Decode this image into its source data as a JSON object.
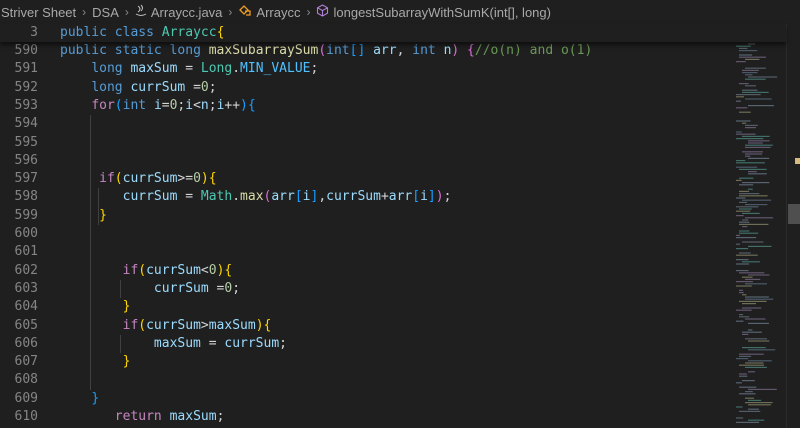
{
  "breadcrumb": {
    "items": [
      {
        "label": "Striver Sheet",
        "icon": ""
      },
      {
        "label": "DSA",
        "icon": ""
      },
      {
        "label": "Arraycc.java",
        "icon": "java-file-icon"
      },
      {
        "label": "Arraycc",
        "icon": "class-icon"
      },
      {
        "label": "longestSubarrayWithSumK(int[], long)",
        "icon": "method-icon"
      }
    ]
  },
  "sticky": {
    "line_number": "3",
    "tokens": [
      {
        "t": "public ",
        "c": "kw"
      },
      {
        "t": "class ",
        "c": "kw"
      },
      {
        "t": "Arraycc",
        "c": "ty"
      },
      {
        "t": "{",
        "c": "b1"
      }
    ]
  },
  "lines": [
    {
      "n": "590",
      "tokens": [
        {
          "t": "public ",
          "c": "kw"
        },
        {
          "t": "static ",
          "c": "kw"
        },
        {
          "t": "long ",
          "c": "kw"
        },
        {
          "t": "maxSubarraySum",
          "c": "fn"
        },
        {
          "t": "(",
          "c": "b2"
        },
        {
          "t": "int",
          "c": "kw"
        },
        {
          "t": "[] ",
          "c": "b3"
        },
        {
          "t": "arr",
          "c": "vr"
        },
        {
          "t": ", ",
          "c": "op"
        },
        {
          "t": "int ",
          "c": "kw"
        },
        {
          "t": "n",
          "c": "vr"
        },
        {
          "t": ") ",
          "c": "b2"
        },
        {
          "t": "{",
          "c": "b2"
        },
        {
          "t": "//o(n) and o(1)",
          "c": "cm"
        }
      ]
    },
    {
      "n": "591",
      "tokens": [
        {
          "t": "    ",
          "c": "op"
        },
        {
          "t": "long ",
          "c": "kw"
        },
        {
          "t": "maxSum",
          "c": "vr"
        },
        {
          "t": " = ",
          "c": "op"
        },
        {
          "t": "Long",
          "c": "ty"
        },
        {
          "t": ".",
          "c": "op"
        },
        {
          "t": "MIN_VALUE",
          "c": "cn"
        },
        {
          "t": ";",
          "c": "op"
        }
      ]
    },
    {
      "n": "592",
      "tokens": [
        {
          "t": "    ",
          "c": "op"
        },
        {
          "t": "long ",
          "c": "kw"
        },
        {
          "t": "currSum",
          "c": "vr"
        },
        {
          "t": " =",
          "c": "op"
        },
        {
          "t": "0",
          "c": "nm"
        },
        {
          "t": ";",
          "c": "op"
        }
      ]
    },
    {
      "n": "593",
      "tokens": [
        {
          "t": "    ",
          "c": "op"
        },
        {
          "t": "for",
          "c": "ctl"
        },
        {
          "t": "(",
          "c": "b3"
        },
        {
          "t": "int ",
          "c": "kw"
        },
        {
          "t": "i",
          "c": "vr"
        },
        {
          "t": "=",
          "c": "op"
        },
        {
          "t": "0",
          "c": "nm"
        },
        {
          "t": ";",
          "c": "op"
        },
        {
          "t": "i",
          "c": "vr"
        },
        {
          "t": "<",
          "c": "op"
        },
        {
          "t": "n",
          "c": "vr"
        },
        {
          "t": ";",
          "c": "op"
        },
        {
          "t": "i",
          "c": "vr"
        },
        {
          "t": "++",
          "c": "op"
        },
        {
          "t": "){",
          "c": "b3"
        }
      ]
    },
    {
      "n": "594",
      "tokens": []
    },
    {
      "n": "595",
      "tokens": []
    },
    {
      "n": "596",
      "tokens": []
    },
    {
      "n": "597",
      "tokens": [
        {
          "t": "     ",
          "c": "op"
        },
        {
          "t": "if",
          "c": "ctl"
        },
        {
          "t": "(",
          "c": "b1"
        },
        {
          "t": "currSum",
          "c": "vr"
        },
        {
          "t": ">=",
          "c": "op"
        },
        {
          "t": "0",
          "c": "nm"
        },
        {
          "t": "){",
          "c": "b1"
        }
      ]
    },
    {
      "n": "598",
      "tokens": [
        {
          "t": "        ",
          "c": "op"
        },
        {
          "t": "currSum",
          "c": "vr"
        },
        {
          "t": " = ",
          "c": "op"
        },
        {
          "t": "Math",
          "c": "ty"
        },
        {
          "t": ".",
          "c": "op"
        },
        {
          "t": "max",
          "c": "fn"
        },
        {
          "t": "(",
          "c": "b2"
        },
        {
          "t": "arr",
          "c": "vr"
        },
        {
          "t": "[",
          "c": "b3"
        },
        {
          "t": "i",
          "c": "vr"
        },
        {
          "t": "]",
          "c": "b3"
        },
        {
          "t": ",",
          "c": "op"
        },
        {
          "t": "currSum",
          "c": "vr"
        },
        {
          "t": "+",
          "c": "op"
        },
        {
          "t": "arr",
          "c": "vr"
        },
        {
          "t": "[",
          "c": "b3"
        },
        {
          "t": "i",
          "c": "vr"
        },
        {
          "t": "]",
          "c": "b3"
        },
        {
          "t": ")",
          "c": "b2"
        },
        {
          "t": ";",
          "c": "op"
        }
      ]
    },
    {
      "n": "599",
      "tokens": [
        {
          "t": "     ",
          "c": "op"
        },
        {
          "t": "}",
          "c": "b1"
        }
      ]
    },
    {
      "n": "600",
      "tokens": []
    },
    {
      "n": "601",
      "tokens": []
    },
    {
      "n": "602",
      "tokens": [
        {
          "t": "        ",
          "c": "op"
        },
        {
          "t": "if",
          "c": "ctl"
        },
        {
          "t": "(",
          "c": "b1"
        },
        {
          "t": "currSum",
          "c": "vr"
        },
        {
          "t": "<",
          "c": "op"
        },
        {
          "t": "0",
          "c": "nm"
        },
        {
          "t": "){",
          "c": "b1"
        }
      ]
    },
    {
      "n": "603",
      "tokens": [
        {
          "t": "            ",
          "c": "op"
        },
        {
          "t": "currSum",
          "c": "vr"
        },
        {
          "t": " =",
          "c": "op"
        },
        {
          "t": "0",
          "c": "nm"
        },
        {
          "t": ";",
          "c": "op"
        }
      ]
    },
    {
      "n": "604",
      "tokens": [
        {
          "t": "        ",
          "c": "op"
        },
        {
          "t": "}",
          "c": "b1"
        }
      ]
    },
    {
      "n": "605",
      "tokens": [
        {
          "t": "        ",
          "c": "op"
        },
        {
          "t": "if",
          "c": "ctl"
        },
        {
          "t": "(",
          "c": "b1"
        },
        {
          "t": "currSum",
          "c": "vr"
        },
        {
          "t": ">",
          "c": "op"
        },
        {
          "t": "maxSum",
          "c": "vr"
        },
        {
          "t": "){",
          "c": "b1"
        }
      ]
    },
    {
      "n": "606",
      "tokens": [
        {
          "t": "            ",
          "c": "op"
        },
        {
          "t": "maxSum",
          "c": "vr"
        },
        {
          "t": " = ",
          "c": "op"
        },
        {
          "t": "currSum",
          "c": "vr"
        },
        {
          "t": ";",
          "c": "op"
        }
      ]
    },
    {
      "n": "607",
      "tokens": [
        {
          "t": "        ",
          "c": "op"
        },
        {
          "t": "}",
          "c": "b1"
        }
      ]
    },
    {
      "n": "608",
      "tokens": []
    },
    {
      "n": "609",
      "tokens": [
        {
          "t": "    ",
          "c": "op"
        },
        {
          "t": "}",
          "c": "b3"
        }
      ]
    },
    {
      "n": "610",
      "tokens": [
        {
          "t": "       ",
          "c": "op"
        },
        {
          "t": "return ",
          "c": "ctl"
        },
        {
          "t": "maxSum",
          "c": "vr"
        },
        {
          "t": ";",
          "c": "op"
        }
      ]
    }
  ],
  "colors": {
    "background": "#1f1f1f",
    "line_number": "#858585",
    "keyword": "#569cd6",
    "control": "#c586c0",
    "type": "#4ec9b0",
    "function": "#dcdcaa",
    "variable": "#9cdcfe",
    "number": "#b5cea8",
    "comment": "#6a9955"
  }
}
